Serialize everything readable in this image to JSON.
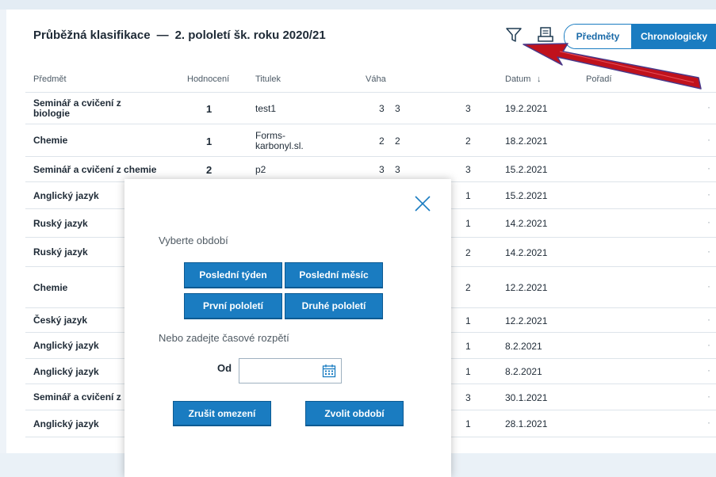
{
  "header": {
    "title": "Průběžná klasifikace",
    "dash": "—",
    "period": "2. pololetí šk. roku 2020/21",
    "toggle": {
      "option1": "Předměty",
      "option2": "Chronologicky",
      "active": "Chronologicky"
    }
  },
  "table": {
    "columns": [
      "Předmět",
      "Hodnocení",
      "Titulek",
      "Váha",
      "Datum",
      "↓",
      "Pořadí"
    ],
    "rows": [
      {
        "subject": "Seminář a cvičení z biologie",
        "subject_lines": [
          "Seminář a cvičení z",
          "biologie"
        ],
        "grade": "1",
        "title_lines": [
          "test1"
        ],
        "w1": "3",
        "w2": "3",
        "ord": "3",
        "date": "19.2.2021"
      },
      {
        "subject": "Chemie",
        "subject_lines": [
          "Chemie"
        ],
        "grade": "1",
        "title_lines": [
          "Forms-",
          "karbonyl.sl."
        ],
        "w1": "2",
        "w2": "2",
        "ord": "2",
        "date": "18.2.2021"
      },
      {
        "subject": "Seminář a cvičení z chemie",
        "subject_lines": [
          "Seminář a cvičení z chemie"
        ],
        "grade": "2",
        "title_lines": [
          "p2"
        ],
        "w1": "3",
        "w2": "3",
        "ord": "3",
        "date": "15.2.2021"
      },
      {
        "subject": "Anglický jazyk",
        "subject_lines": [
          "Anglický jazyk"
        ],
        "grade": "",
        "title_lines": [
          ""
        ],
        "w1": "",
        "w2": "",
        "ord": "1",
        "date": "15.2.2021"
      },
      {
        "subject": "Ruský jazyk",
        "subject_lines": [
          "Ruský jazyk"
        ],
        "grade": "",
        "title_lines": [
          ""
        ],
        "w1": "",
        "w2": "",
        "ord": "1",
        "date": "14.2.2021"
      },
      {
        "subject": "Ruský jazyk",
        "subject_lines": [
          "Ruský jazyk"
        ],
        "grade": "",
        "title_lines": [
          ""
        ],
        "w1": "",
        "w2": "",
        "ord": "2",
        "date": "14.2.2021"
      },
      {
        "subject": "Chemie",
        "subject_lines": [
          "Chemie"
        ],
        "grade": "",
        "title_lines": [
          ""
        ],
        "w1": "",
        "w2": "",
        "ord": "2",
        "date": "12.2.2021"
      },
      {
        "subject": "Český jazyk",
        "subject_lines": [
          "Český jazyk"
        ],
        "grade": "",
        "title_lines": [
          ""
        ],
        "w1": "",
        "w2": "",
        "ord": "1",
        "date": "12.2.2021"
      },
      {
        "subject": "Anglický jazyk",
        "subject_lines": [
          "Anglický jazyk"
        ],
        "grade": "",
        "title_lines": [
          ""
        ],
        "w1": "",
        "w2": "",
        "ord": "1",
        "date": "8.2.2021"
      },
      {
        "subject": "Anglický jazyk",
        "subject_lines": [
          "Anglický jazyk"
        ],
        "grade": "",
        "title_lines": [
          ""
        ],
        "w1": "",
        "w2": "",
        "ord": "1",
        "date": "8.2.2021"
      },
      {
        "subject": "Seminář a cvičení z",
        "subject_lines": [
          "Seminář a cvičení z"
        ],
        "grade": "",
        "title_lines": [
          ""
        ],
        "w1": "",
        "w2": "",
        "ord": "3",
        "date": "30.1.2021"
      },
      {
        "subject": "Anglický jazyk",
        "subject_lines": [
          "Anglický jazyk"
        ],
        "grade": "",
        "title_lines": [
          ""
        ],
        "w1": "",
        "w2": "",
        "ord": "1",
        "date": "28.1.2021"
      }
    ]
  },
  "modal": {
    "choose_period": "Vyberte období",
    "btn_last_week": "Poslední týden",
    "btn_last_month": "Poslední měsíc",
    "btn_first_half": "První pololetí",
    "btn_second_half": "Druhé pololetí",
    "or_range": "Nebo zadejte časové rozpětí",
    "from_label": "Od",
    "from_value": "",
    "btn_clear": "Zrušit omezení",
    "btn_apply": "Zvolit období"
  },
  "icons": {
    "filter": "filter-icon",
    "print": "print-icon",
    "close": "close-icon",
    "calendar": "calendar-icon",
    "annotation": "red-arrow-annotation"
  },
  "colors": {
    "accent": "#1a7cc1",
    "arrow_red": "#c0121c",
    "arrow_outline": "#4a3a8a",
    "text": "#1e2a36"
  }
}
